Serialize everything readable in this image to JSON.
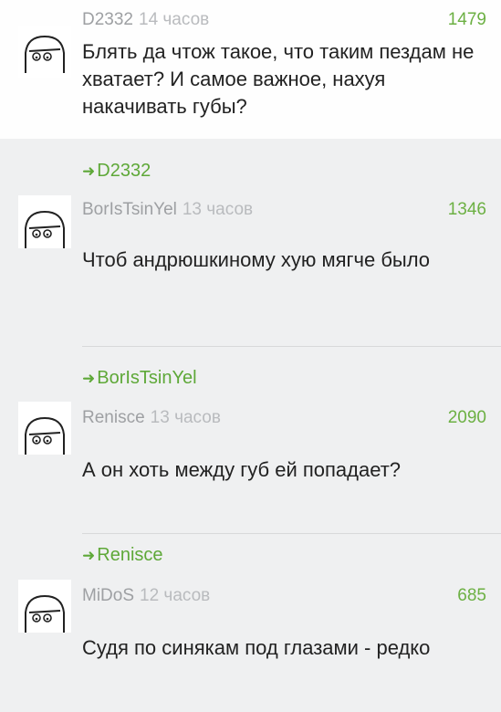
{
  "comments": [
    {
      "author": "D2332",
      "time": "14 часов",
      "score": "1479",
      "text": "Блять да чтож такое, что таким пездам не хватает? И самое важное, нахуя накачивать губы?"
    },
    {
      "reply_to": "D2332",
      "author": "BorIsTsinYel",
      "time": "13 часов",
      "score": "1346",
      "text": "Чтоб андрюшкиному хую мягче было"
    },
    {
      "reply_to": "BorIsTsinYel",
      "author": "Renisce",
      "time": "13 часов",
      "score": "2090",
      "text": "А он хоть между губ ей попадает?"
    },
    {
      "reply_to": "Renisce",
      "author": "MiDoS",
      "time": "12 часов",
      "score": "685",
      "text": "Судя по синякам под глазами - редко"
    }
  ],
  "icons": {
    "reply_arrow": "reply-arrow-icon",
    "avatar": "troll-face-avatar-icon"
  },
  "colors": {
    "score": "#6cb043",
    "reply_link": "#5ea838",
    "author": "#9ea0a3",
    "background": "#eff0f1"
  }
}
